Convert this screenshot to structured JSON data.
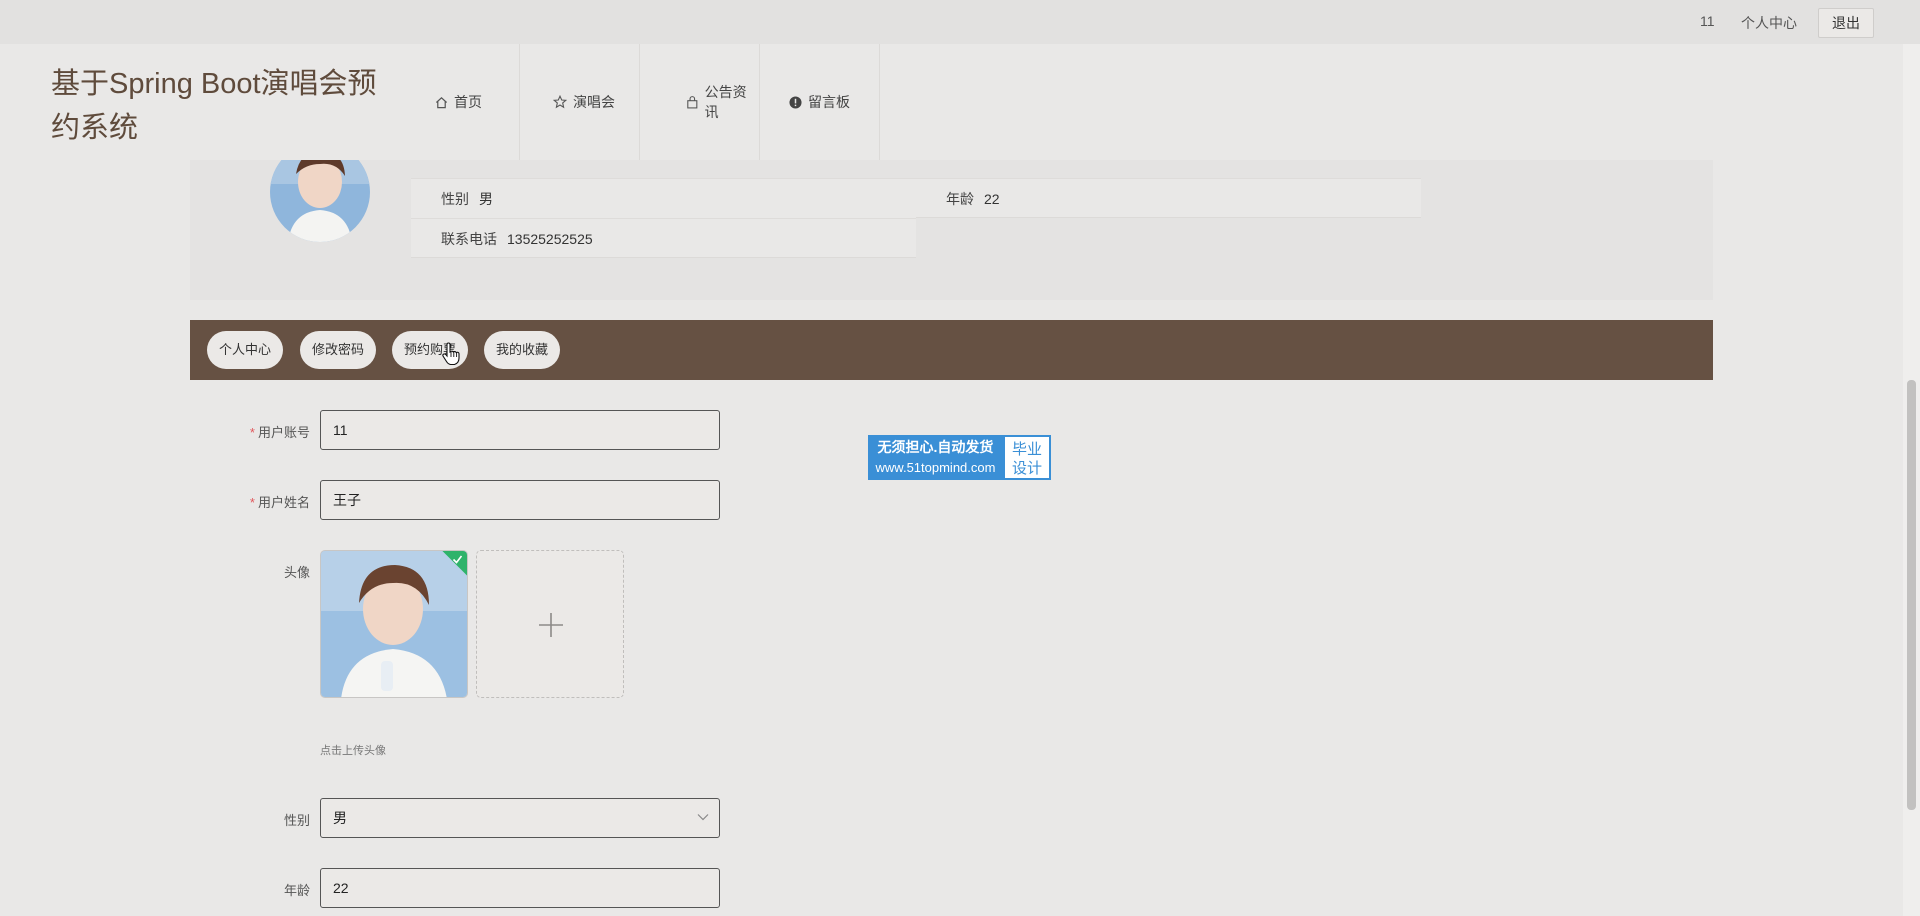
{
  "topbar": {
    "username": "11",
    "profile_link": "个人中心",
    "logout_label": "退出"
  },
  "header": {
    "title": "基于Spring Boot演唱会预约系统"
  },
  "nav": [
    {
      "label": "首页",
      "icon": "home-icon"
    },
    {
      "label": "演唱会",
      "icon": "star-icon"
    },
    {
      "label": "公告资讯",
      "icon": "bag-icon"
    },
    {
      "label": "留言板",
      "icon": "alert-circle-icon"
    }
  ],
  "profile": {
    "gender_label": "性别",
    "gender_value": "男",
    "age_label": "年龄",
    "age_value": "22",
    "phone_label": "联系电话",
    "phone_value": "13525252525"
  },
  "tabs": [
    {
      "label": "个人中心"
    },
    {
      "label": "修改密码"
    },
    {
      "label": "预约购票"
    },
    {
      "label": "我的收藏"
    }
  ],
  "form": {
    "account_label": "用户账号",
    "account_value": "11",
    "name_label": "用户姓名",
    "name_value": "王子",
    "avatar_label": "头像",
    "avatar_tip": "点击上传头像",
    "gender_label": "性别",
    "gender_value": "男",
    "age_label": "年龄",
    "age_value": "22",
    "required_mark": "*"
  },
  "ad": {
    "line1": "无须担心.自动发货",
    "line2": "www.51topmind.com",
    "right1": "毕业",
    "right2": "设计"
  },
  "colors": {
    "accent_brown": "#665143",
    "title_brown": "#5f4b3c",
    "ad_blue": "#3a8fd6",
    "success_green": "#2fb36b"
  }
}
